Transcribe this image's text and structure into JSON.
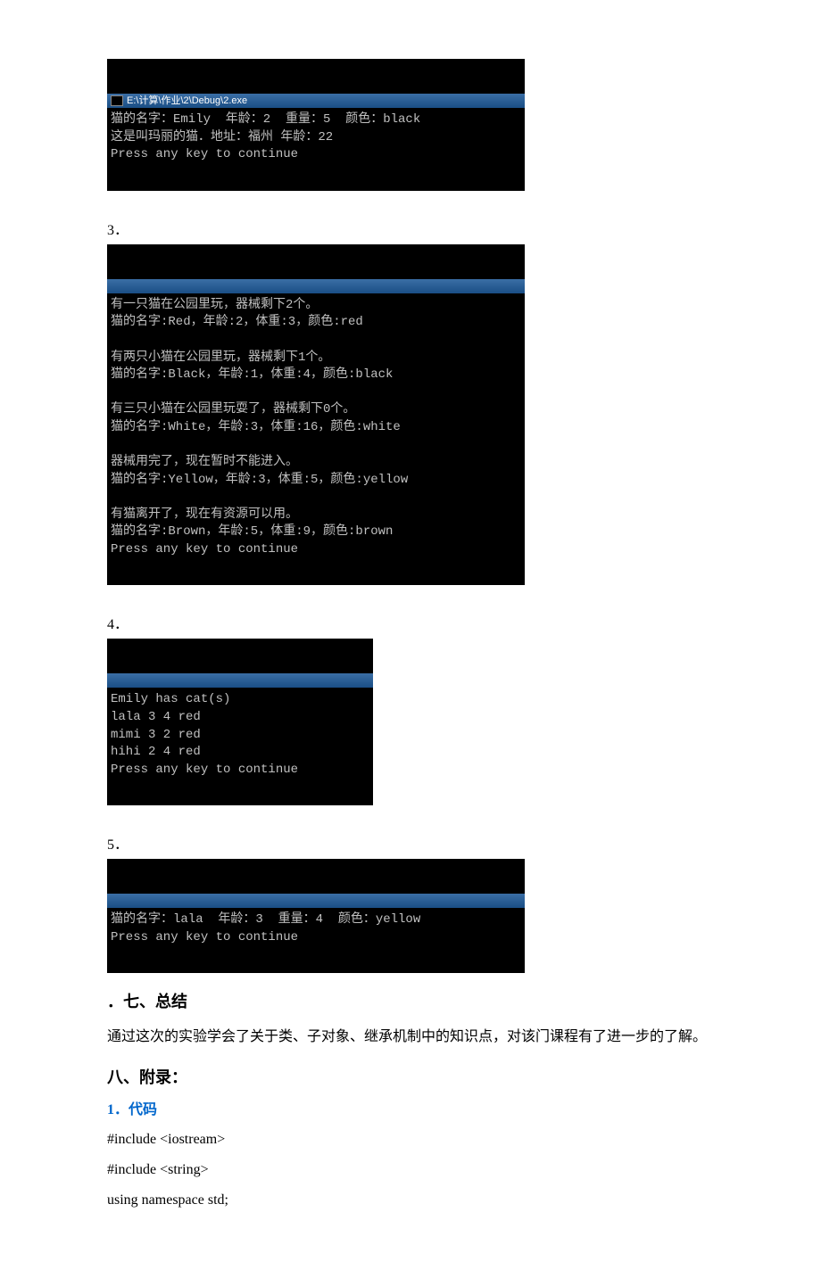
{
  "console2": {
    "title": "E:\\计算\\作业\\2\\Debug\\2.exe",
    "line1": "猫的名字：Emily  年龄：2  重量：5  颜色：black",
    "line2": "这是叫玛丽的猫．地址：福州 年龄：22",
    "line3": "Press any key to continue"
  },
  "label3": "3．",
  "console3": {
    "l1": "有一只猫在公园里玩，器械剩下2个。",
    "l2": "猫的名字:Red，年龄:2，体重:3，颜色:red",
    "l3": "",
    "l4": "有两只小猫在公园里玩，器械剩下1个。",
    "l5": "猫的名字:Black，年龄:1，体重:4，颜色:black",
    "l6": "",
    "l7": "有三只小猫在公园里玩耍了，器械剩下0个。",
    "l8": "猫的名字:White，年龄:3，体重:16，颜色:white",
    "l9": "",
    "l10": "器械用完了，现在暂时不能进入。",
    "l11": "猫的名字:Yellow，年龄:3，体重:5，颜色:yellow",
    "l12": "",
    "l13": "有猫离开了，现在有资源可以用。",
    "l14": "猫的名字:Brown，年龄:5，体重:9，颜色:brown",
    "l15": "Press any key to continue"
  },
  "label4": "4．",
  "console4": {
    "l1": "Emily has cat(s)",
    "l2": "lala 3 4 red",
    "l3": "mimi 3 2 red",
    "l4": "hihi 2 4 red",
    "l5": "Press any key to continue"
  },
  "label5": "5．",
  "console5": {
    "l1": "猫的名字：lala  年龄：3  重量：4  颜色：yellow",
    "l2": "Press any key to continue"
  },
  "section7_title": "．七、总结",
  "section7_para": "通过这次的实验学会了关于类、子对象、继承机制中的知识点，对该门课程有了进一步的了解。",
  "section8_title": "八、附录：",
  "code_heading": "1．代码",
  "code1": "#include <iostream>",
  "code2": "#include <string>",
  "code3": "using namespace std;"
}
